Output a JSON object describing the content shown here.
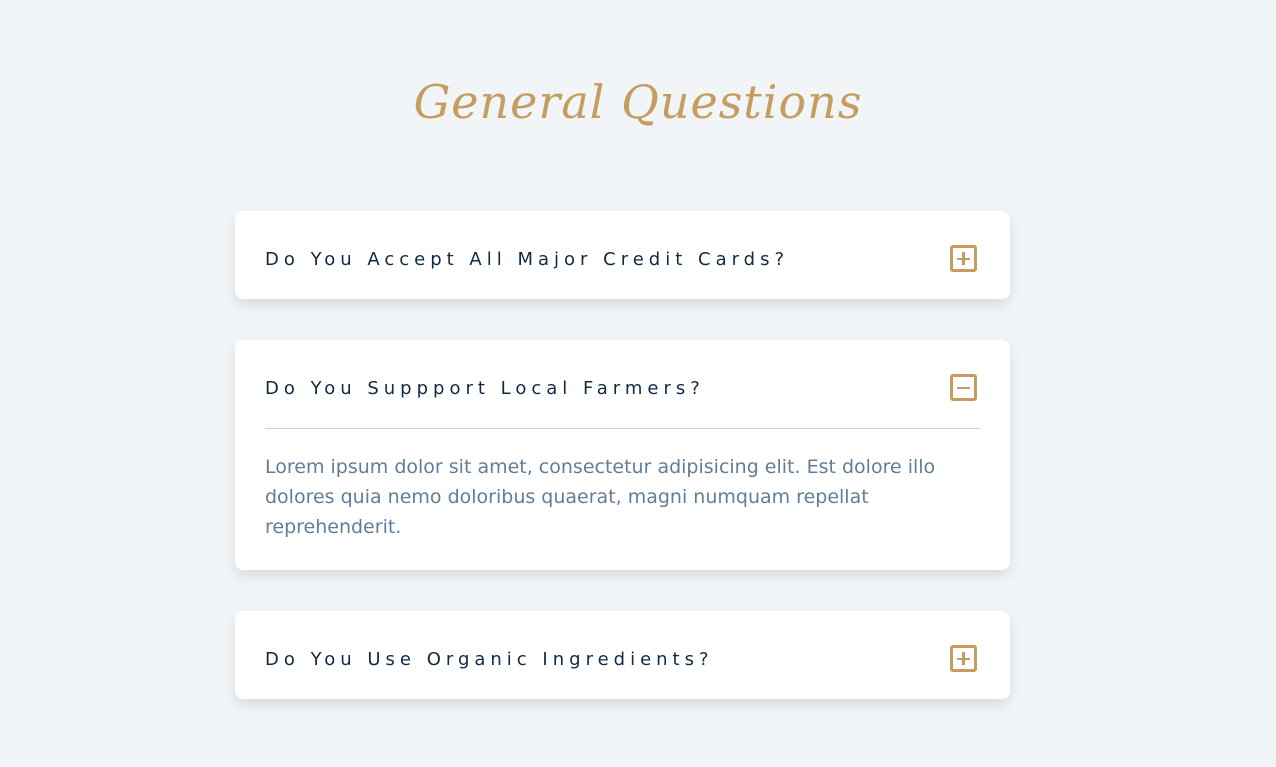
{
  "page": {
    "title": "General Questions"
  },
  "colors": {
    "background": "#f1f5f8",
    "accent": "#c59d5f",
    "question_text": "#102a42",
    "answer_text": "#617d98",
    "card": "#ffffff"
  },
  "faqs": [
    {
      "question": "Do You Accept All Major Credit Cards?",
      "expanded": false,
      "toggle_icon": "plus-square-icon",
      "answer": ""
    },
    {
      "question": "Do You Suppport Local Farmers?",
      "expanded": true,
      "toggle_icon": "minus-square-icon",
      "answer": "Lorem ipsum dolor sit amet, consectetur adipisicing elit. Est dolore illo dolores quia nemo doloribus quaerat, magni numquam repellat reprehenderit."
    },
    {
      "question": "Do You Use Organic Ingredients?",
      "expanded": false,
      "toggle_icon": "plus-square-icon",
      "answer": ""
    }
  ]
}
